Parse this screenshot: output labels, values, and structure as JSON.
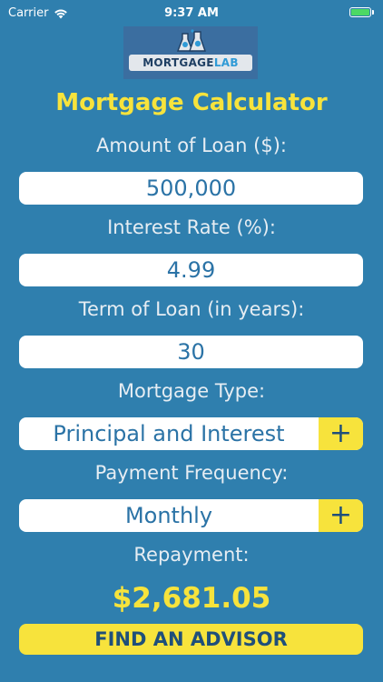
{
  "status_bar": {
    "carrier": "Carrier",
    "time": "9:37 AM"
  },
  "logo": {
    "text_main": "MORTGAGE",
    "text_accent": "LAB"
  },
  "title": "Mortgage Calculator",
  "loan_amount": {
    "label": "Amount of Loan ($):",
    "value": "500,000"
  },
  "interest_rate": {
    "label": "Interest Rate (%):",
    "value": "4.99"
  },
  "loan_term": {
    "label": "Term of Loan (in years):",
    "value": "30"
  },
  "mortgage_type": {
    "label": "Mortgage Type:",
    "value": "Principal and Interest",
    "button": "+"
  },
  "payment_frequency": {
    "label": "Payment Frequency:",
    "value": "Monthly",
    "button": "+"
  },
  "repayment": {
    "label": "Repayment:",
    "value": "$2,681.05"
  },
  "advisor_button": "FIND AN ADVISOR",
  "colors": {
    "background": "#2f7fae",
    "accent_yellow": "#f7e33c",
    "field_text": "#2b73a6"
  }
}
